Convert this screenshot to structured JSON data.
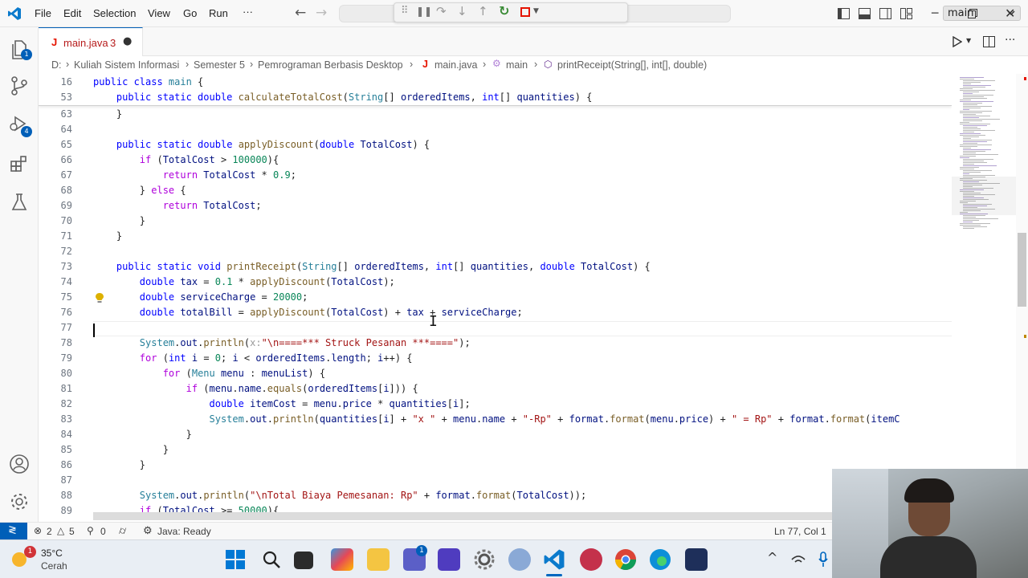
{
  "menu": {
    "file": "File",
    "edit": "Edit",
    "selection": "Selection",
    "view": "View",
    "go": "Go",
    "run": "Run",
    "more": "···"
  },
  "debug": {
    "branch": "main"
  },
  "activity": {
    "explorer_badge": "1",
    "run_badge": "4"
  },
  "tab": {
    "label": "main.java",
    "problems": "3",
    "modified_dot": "●"
  },
  "breadcrumb": {
    "items": [
      "D:",
      "Kuliah Sistem Informasi",
      "Semester 5",
      "Pemrograman Berbasis Desktop",
      "main.java",
      "main",
      "printReceipt(String[], int[], double)"
    ],
    "sep": "›"
  },
  "editor": {
    "sticky": [
      {
        "num": "16",
        "code": "public class main {"
      },
      {
        "num": "53",
        "code": "    public static double calculateTotalCost(String[] orderedItems, int[] quantities) {"
      }
    ],
    "lines": [
      {
        "num": "63",
        "code": "    }"
      },
      {
        "num": "64",
        "code": ""
      },
      {
        "num": "65",
        "code": "    public static double applyDiscount(double TotalCost) {"
      },
      {
        "num": "66",
        "code": "        if (TotalCost > 100000){"
      },
      {
        "num": "67",
        "code": "            return TotalCost * 0.9;"
      },
      {
        "num": "68",
        "code": "        } else {"
      },
      {
        "num": "69",
        "code": "            return TotalCost;"
      },
      {
        "num": "70",
        "code": "        }"
      },
      {
        "num": "71",
        "code": "    }"
      },
      {
        "num": "72",
        "code": ""
      },
      {
        "num": "73",
        "code": "    public static void printReceipt(String[] orderedItems, int[] quantities, double TotalCost) {"
      },
      {
        "num": "74",
        "code": "        double tax = 0.1 * applyDiscount(TotalCost);"
      },
      {
        "num": "75",
        "code": "        double serviceCharge = 20000;"
      },
      {
        "num": "76",
        "code": "        double totalBill = applyDiscount(TotalCost) + tax + serviceCharge;"
      },
      {
        "num": "77",
        "code": ""
      },
      {
        "num": "78",
        "code": "        System.out.println(x:\"\\n====*** Struck Pesanan ***====\");"
      },
      {
        "num": "79",
        "code": "        for (int i = 0; i < orderedItems.length; i++) {"
      },
      {
        "num": "80",
        "code": "            for (Menu menu : menuList) {"
      },
      {
        "num": "81",
        "code": "                if (menu.name.equals(orderedItems[i])) {"
      },
      {
        "num": "82",
        "code": "                    double itemCost = menu.price * quantities[i];"
      },
      {
        "num": "83",
        "code": "                    System.out.println(quantities[i] + \"x \" + menu.name + \"-Rp\" + format.format(menu.price) + \" = Rp\" + format.format(itemC"
      },
      {
        "num": "84",
        "code": "                }"
      },
      {
        "num": "85",
        "code": "            }"
      },
      {
        "num": "86",
        "code": "        }"
      },
      {
        "num": "87",
        "code": ""
      },
      {
        "num": "88",
        "code": "        System.out.println(\"\\nTotal Biaya Pemesanan: Rp\" + format.format(TotalCost));"
      },
      {
        "num": "89",
        "code": "        if (TotalCost >= 50000){"
      }
    ]
  },
  "status": {
    "errors": "2",
    "warnings": "5",
    "ports": "0",
    "java": "Java: Ready",
    "position": "Ln 77, Col 1"
  },
  "weather": {
    "temp": "35°C",
    "desc": "Cerah",
    "alert": "1"
  },
  "taskbar": {
    "teams_badge": "1"
  }
}
